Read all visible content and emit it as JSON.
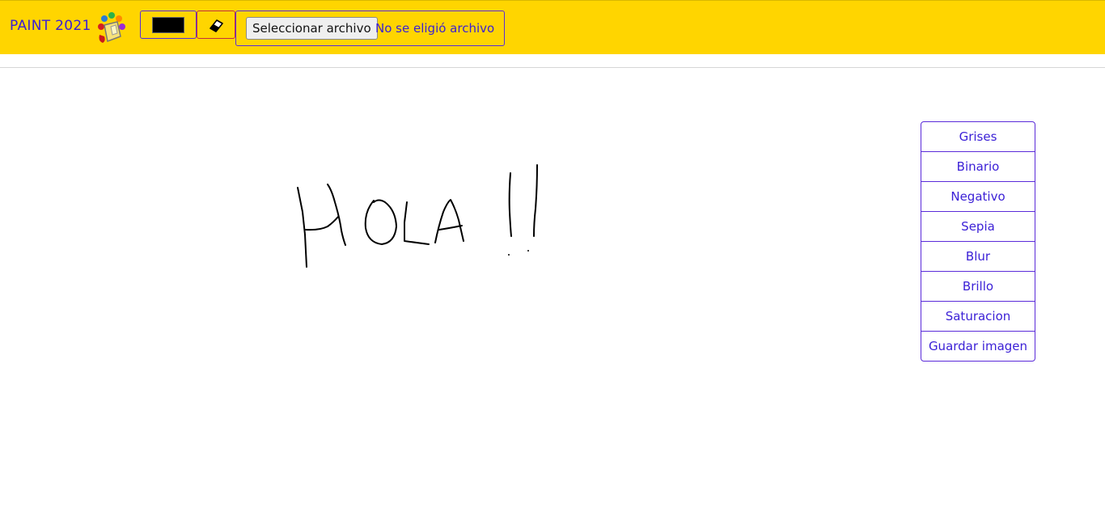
{
  "app": {
    "brand": "PAINT 2021",
    "logo_icon": "paint-bucket-icon"
  },
  "toolbar": {
    "color_value": "#000000",
    "eraser_icon": "eraser-icon",
    "file_button_label": "Seleccionar archivo",
    "file_status": "No se eligió archivo"
  },
  "filters": {
    "items": [
      {
        "label": "Grises"
      },
      {
        "label": "Binario"
      },
      {
        "label": "Negativo"
      },
      {
        "label": "Sepia"
      },
      {
        "label": "Blur"
      },
      {
        "label": "Brillo"
      },
      {
        "label": "Saturacion"
      },
      {
        "label": "Guardar imagen"
      }
    ]
  },
  "colors": {
    "navbar_bg": "#ffd500",
    "accent": "#3a1fd6",
    "stroke": "#000000"
  }
}
